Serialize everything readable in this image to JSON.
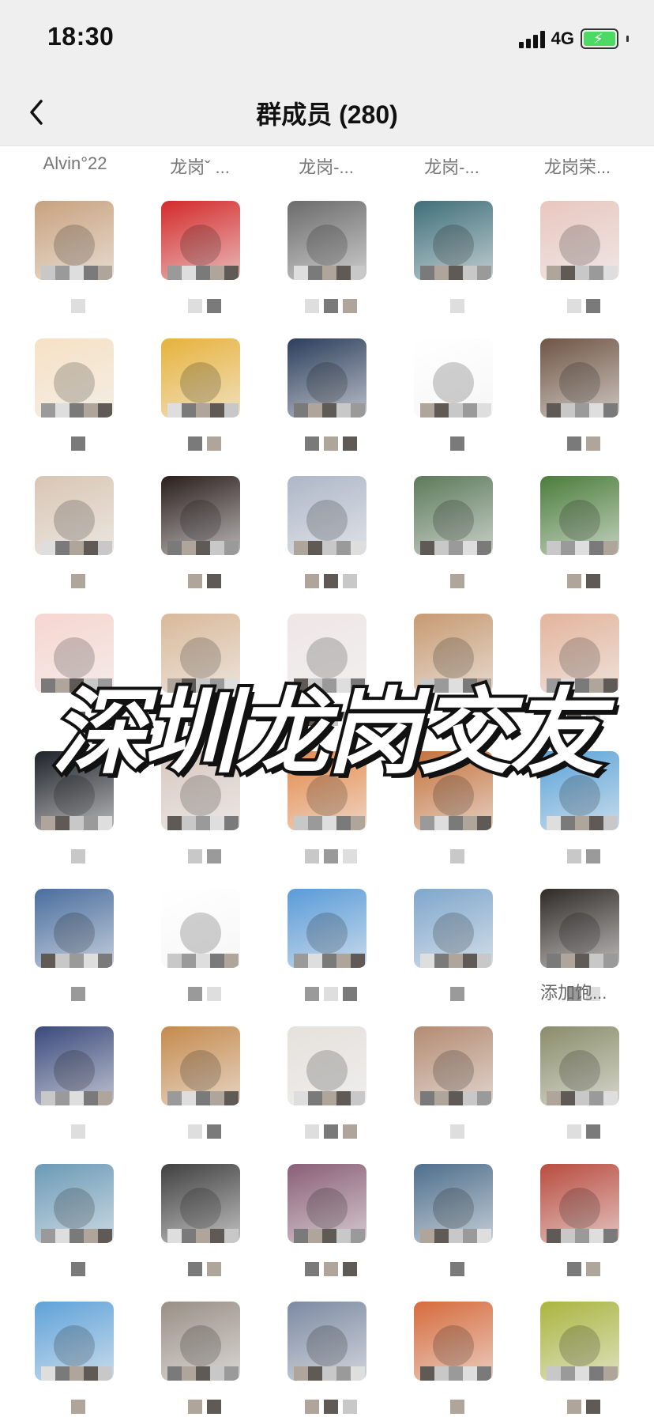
{
  "status_bar": {
    "time": "18:30",
    "network": "4G"
  },
  "nav": {
    "title": "群成员 (280)"
  },
  "top_names": [
    "Alvin°22",
    "龙岗ˇ ...",
    "龙岗-...",
    "龙岗-...",
    "龙岗荣..."
  ],
  "overlay_caption": "深圳龙岗交友",
  "extra_label": "添加饱...",
  "colors": {
    "status_bg": "#efefef",
    "text_primary": "#111111",
    "text_secondary": "#777777",
    "battery_green": "#4cd964"
  },
  "members": [
    [
      "#c9a27e",
      "#d42a2a",
      "#6b6b6b",
      "#3f6f7a",
      "#e8c7bf"
    ],
    [
      "#f6e1c4",
      "#e7b23b",
      "#2c3e5c",
      "#ffffff",
      "#6f5544"
    ],
    [
      "#d9c6b4",
      "#2a1e1c",
      "#aeb7c8",
      "#5d7a5b",
      "#4b7d3b"
    ],
    [
      "#f7d6d0",
      "#d9b99a",
      "#efe6e6",
      "#c79a72",
      "#e3b49c"
    ],
    [
      "#1e2229",
      "#d8c8c0",
      "#e4894a",
      "#c4723c",
      "#5ba3d9"
    ],
    [
      "#4a6e9e",
      "#ffffff",
      "#5a9bd8",
      "#7fa7cc",
      "#2f2a26"
    ],
    [
      "#3b4a7c",
      "#c58a4d",
      "#e5e1dc",
      "#b48b72",
      "#8a8d6a"
    ],
    [
      "#6b9ab7",
      "#404040",
      "#8a5f77",
      "#4e6f8c",
      "#b94c3f"
    ],
    [
      "#5fa2d9",
      "#9a8f86",
      "#7c8aa2",
      "#d66b3c",
      "#aab540"
    ]
  ]
}
